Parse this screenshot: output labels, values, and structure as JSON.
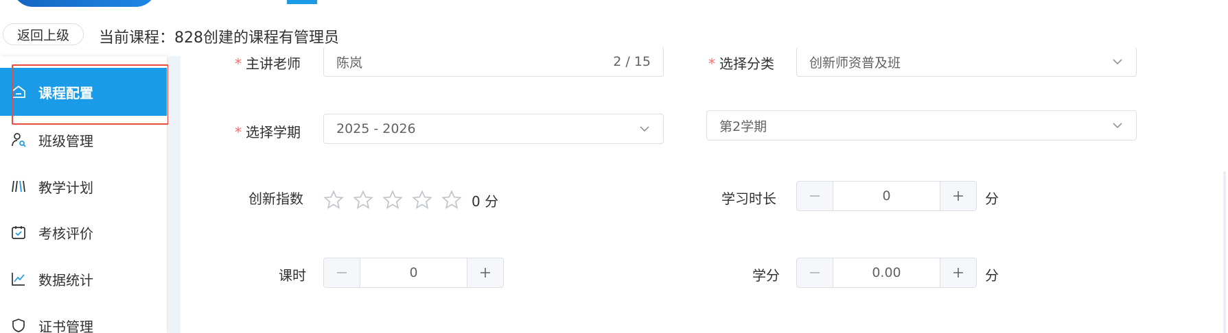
{
  "header": {
    "back_label": "返回上级",
    "course_title": "当前课程：828创建的课程有管理员"
  },
  "sidebar": {
    "items": [
      {
        "label": "课程配置",
        "icon": "home-icon",
        "active": true
      },
      {
        "label": "班级管理",
        "icon": "user-search-icon",
        "active": false
      },
      {
        "label": "教学计划",
        "icon": "books-icon",
        "active": false
      },
      {
        "label": "考核评价",
        "icon": "calendar-check-icon",
        "active": false
      },
      {
        "label": "数据统计",
        "icon": "line-chart-icon",
        "active": false
      },
      {
        "label": "证书管理",
        "icon": "shield-icon",
        "active": false
      }
    ]
  },
  "form": {
    "teacher": {
      "label": "主讲老师",
      "value": "陈岚",
      "count": "2 / 15",
      "required": true
    },
    "category": {
      "label": "选择分类",
      "value": "创新师资普及班",
      "required": true
    },
    "semester": {
      "label": "选择学期",
      "year_value": "2025 - 2026",
      "term_value": "第2学期",
      "required": true
    },
    "innovation": {
      "label": "创新指数",
      "stars_total": 5,
      "stars_value": 0,
      "score_text": "0 分"
    },
    "study_duration": {
      "label": "学习时长",
      "value": "0",
      "unit": "分"
    },
    "class_hours": {
      "label": "课时",
      "value": "0"
    },
    "credits": {
      "label": "学分",
      "value": "0.00",
      "unit": "分"
    }
  },
  "colors": {
    "accent": "#1a9be8",
    "required": "#f56c6c",
    "highlight": "#e74c3c"
  }
}
